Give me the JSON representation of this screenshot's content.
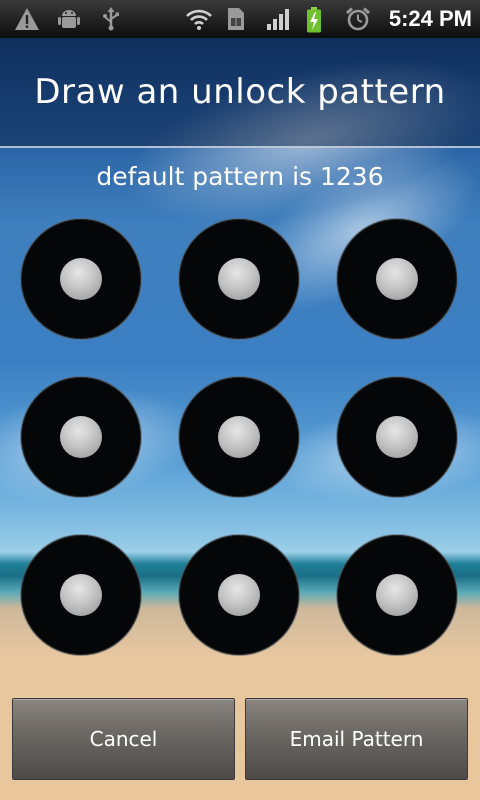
{
  "status_bar": {
    "left_icons": [
      "warning-icon",
      "android-debug-icon",
      "usb-icon"
    ],
    "right_icons": [
      "wifi-icon",
      "sim-card-icon",
      "signal-icon",
      "battery-charging-icon",
      "alarm-clock-icon"
    ],
    "time": "5:24 PM"
  },
  "header": {
    "title": "Draw an unlock pattern"
  },
  "hint": "default pattern is 1236",
  "pattern": {
    "rows": 3,
    "cols": 3
  },
  "buttons": {
    "cancel_label": "Cancel",
    "email_label": "Email Pattern"
  },
  "colors": {
    "node_fill": "#050607",
    "dot_fill": "#c4c4c4",
    "button_gray": "#6d6965"
  }
}
